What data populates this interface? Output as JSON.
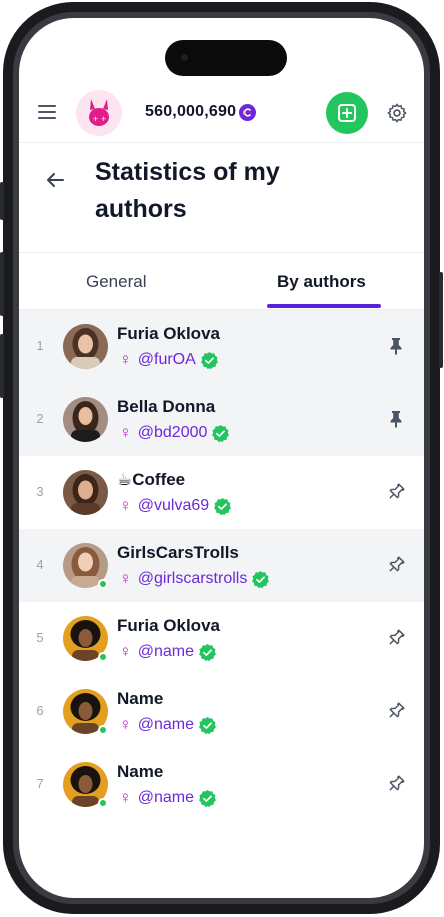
{
  "header": {
    "balance": "560,000,690",
    "icons": {
      "menu": "hamburger-menu-icon",
      "logo": "bunny-logo",
      "coin": "coin-icon",
      "add": "plus-square-icon",
      "settings": "gear-icon"
    }
  },
  "page": {
    "title": "Statistics of my authors"
  },
  "tabs": [
    {
      "label": "General",
      "active": false
    },
    {
      "label": "By authors",
      "active": true
    }
  ],
  "authors": [
    {
      "rank": "1",
      "name": "Furia Oklova",
      "gender": "♀",
      "handle": "@furOA",
      "verified": true,
      "pinned": true,
      "online": false
    },
    {
      "rank": "2",
      "name": "Bella Donna",
      "gender": "♀",
      "handle": "@bd2000",
      "verified": true,
      "pinned": true,
      "online": false
    },
    {
      "rank": "3",
      "name": "☕Coffee",
      "gender": "♀",
      "handle": "@vulva69",
      "verified": true,
      "pinned": false,
      "online": false
    },
    {
      "rank": "4",
      "name": "GirlsCarsTrolls",
      "gender": "♀",
      "handle": "@girlscarstrolls",
      "verified": true,
      "pinned": false,
      "online": true
    },
    {
      "rank": "5",
      "name": "Furia Oklova",
      "gender": "♀",
      "handle": "@name",
      "verified": true,
      "pinned": false,
      "online": true
    },
    {
      "rank": "6",
      "name": "Name",
      "gender": "♀",
      "handle": "@name",
      "verified": true,
      "pinned": false,
      "online": true
    },
    {
      "rank": "7",
      "name": "Name",
      "gender": "♀",
      "handle": "@name",
      "verified": true,
      "pinned": false,
      "online": true
    }
  ],
  "colors": {
    "accent": "#5b21d9",
    "handle": "#6d28d9",
    "gender": "#c026d3",
    "verified": "#22c55e",
    "add_button": "#22c55e",
    "row_shade": "#f3f4f6"
  }
}
